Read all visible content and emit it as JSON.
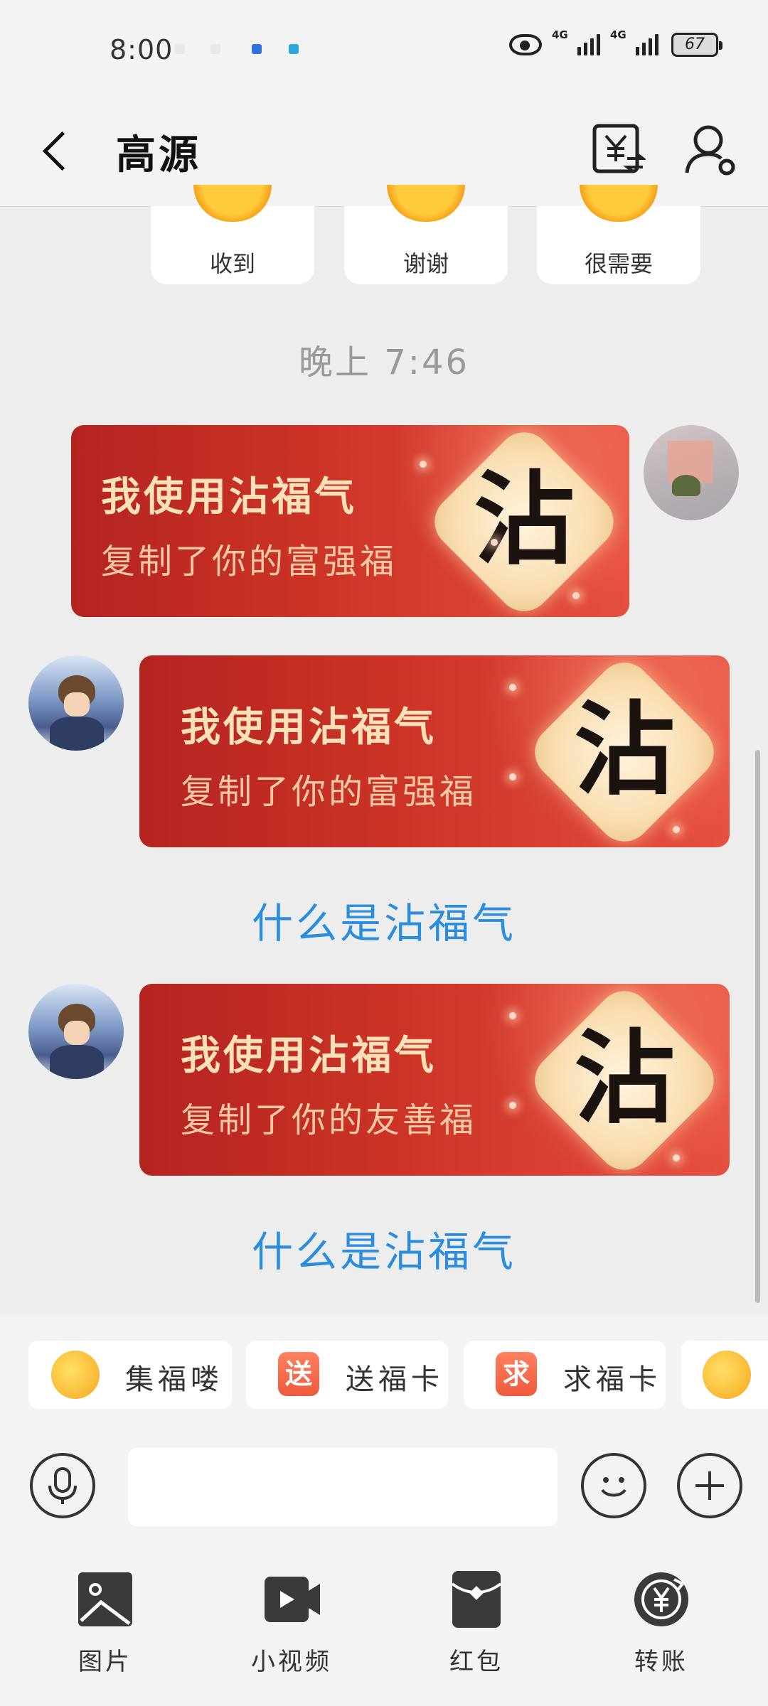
{
  "status_bar": {
    "time": "8:00",
    "net1": "4G",
    "net2": "4G",
    "battery": "67"
  },
  "header": {
    "contact_name": "高源"
  },
  "quick_replies": [
    "收到",
    "谢谢",
    "很需要"
  ],
  "time_stamp": "晚上 7:46",
  "messages": [
    {
      "sender": "self",
      "title": "我使用沾福气",
      "subtitle": "复制了你的富强福",
      "badge_char": "沾"
    },
    {
      "sender": "other",
      "title": "我使用沾福气",
      "subtitle": "复制了你的富强福",
      "badge_char": "沾"
    },
    {
      "sender": "other",
      "title": "我使用沾福气",
      "subtitle": "复制了你的友善福",
      "badge_char": "沾"
    }
  ],
  "what_is_link": "什么是沾福气",
  "chips": [
    {
      "label": "集福喽",
      "icon": "fu-emoji-icon"
    },
    {
      "label": "送福卡",
      "icon_text": "送"
    },
    {
      "label": "求福卡",
      "icon_text": "求"
    }
  ],
  "input": {
    "value": ""
  },
  "tools": [
    {
      "label": "图片",
      "icon": "image-icon"
    },
    {
      "label": "小视频",
      "icon": "video-icon"
    },
    {
      "label": "红包",
      "icon": "red-packet-icon"
    },
    {
      "label": "转账",
      "icon": "transfer-icon"
    }
  ],
  "colors": {
    "accent_link": "#2b8de0",
    "card_red": "#cc3427",
    "background": "#ededed"
  }
}
